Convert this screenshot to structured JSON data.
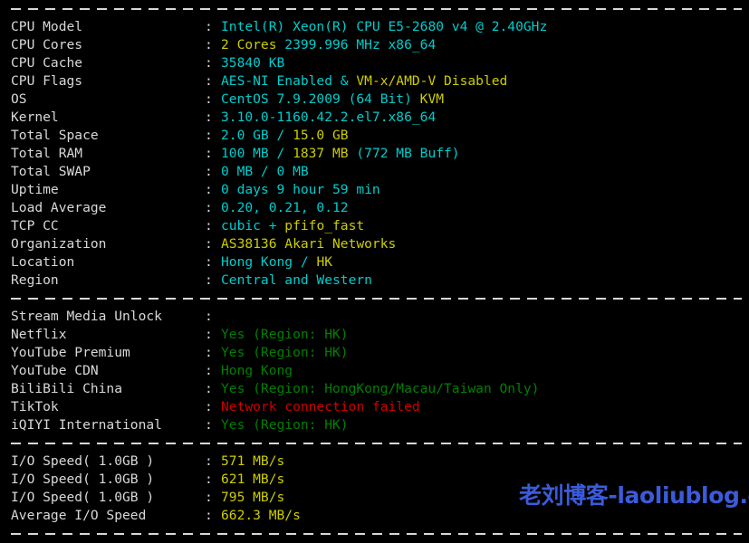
{
  "terminal": {
    "separator_char": "-",
    "colon": ":"
  },
  "watermark": {
    "text": "老刘博客-laoliublog.cn",
    "color": "#3b5bdb"
  },
  "colors": {
    "background": "#000000",
    "label": "#d8d8d8",
    "cyan": "#00cdcd",
    "yellow": "#cdcd00",
    "green": "#008000",
    "red": "#cd0000"
  },
  "sections": [
    {
      "id": "system-info",
      "rows": [
        {
          "label": "CPU Model",
          "parts": [
            {
              "text": "Intel(R) Xeon(R) CPU E5-2680 v4 @ 2.40GHz",
              "color": "cyan"
            }
          ]
        },
        {
          "label": "CPU Cores",
          "parts": [
            {
              "text": "2 Cores ",
              "color": "yellow"
            },
            {
              "text": "2399.996 MHz x86_64",
              "color": "cyan"
            }
          ]
        },
        {
          "label": "CPU Cache",
          "parts": [
            {
              "text": "35840 KB",
              "color": "cyan"
            }
          ]
        },
        {
          "label": "CPU Flags",
          "parts": [
            {
              "text": "AES-NI Enabled ",
              "color": "cyan"
            },
            {
              "text": "& ",
              "color": "cyan"
            },
            {
              "text": "VM-x/AMD-V Disabled",
              "color": "yellow"
            }
          ]
        },
        {
          "label": "OS",
          "parts": [
            {
              "text": "CentOS 7.9.2009 (64 Bit) ",
              "color": "cyan"
            },
            {
              "text": "KVM",
              "color": "yellow"
            }
          ]
        },
        {
          "label": "Kernel",
          "parts": [
            {
              "text": "3.10.0-1160.42.2.el7.x86_64",
              "color": "cyan"
            }
          ]
        },
        {
          "label": "Total Space",
          "parts": [
            {
              "text": "2.0 GB / ",
              "color": "cyan"
            },
            {
              "text": "15.0 GB",
              "color": "yellow"
            }
          ]
        },
        {
          "label": "Total RAM",
          "parts": [
            {
              "text": "100 MB / ",
              "color": "cyan"
            },
            {
              "text": "1837 MB ",
              "color": "yellow"
            },
            {
              "text": "(772 MB Buff)",
              "color": "cyan"
            }
          ]
        },
        {
          "label": "Total SWAP",
          "parts": [
            {
              "text": "0 MB / 0 MB",
              "color": "cyan"
            }
          ]
        },
        {
          "label": "Uptime",
          "parts": [
            {
              "text": "0 days 9 hour 59 min",
              "color": "cyan"
            }
          ]
        },
        {
          "label": "Load Average",
          "parts": [
            {
              "text": "0.20, 0.21, 0.12",
              "color": "cyan"
            }
          ]
        },
        {
          "label": "TCP CC",
          "parts": [
            {
              "text": "cubic + ",
              "color": "cyan"
            },
            {
              "text": "pfifo_fast",
              "color": "yellow"
            }
          ]
        },
        {
          "label": "Organization",
          "parts": [
            {
              "text": "AS38136 Akari Networks",
              "color": "yellow"
            }
          ]
        },
        {
          "label": "Location",
          "parts": [
            {
              "text": "Hong Kong / ",
              "color": "cyan"
            },
            {
              "text": "HK",
              "color": "yellow"
            }
          ]
        },
        {
          "label": "Region",
          "parts": [
            {
              "text": "Central and Western",
              "color": "cyan"
            }
          ]
        }
      ]
    },
    {
      "id": "stream-media-unlock",
      "rows": [
        {
          "label": "Stream Media Unlock",
          "parts": []
        },
        {
          "label": "Netflix",
          "parts": [
            {
              "text": "Yes (Region: HK)",
              "color": "green"
            }
          ]
        },
        {
          "label": "YouTube Premium",
          "parts": [
            {
              "text": "Yes (Region: HK)",
              "color": "green"
            }
          ]
        },
        {
          "label": "YouTube CDN",
          "parts": [
            {
              "text": "Hong Kong",
              "color": "green"
            }
          ]
        },
        {
          "label": "BiliBili China",
          "parts": [
            {
              "text": "Yes (Region: HongKong/Macau/Taiwan Only)",
              "color": "green"
            }
          ]
        },
        {
          "label": "TikTok",
          "parts": [
            {
              "text": "Network connection failed",
              "color": "red"
            }
          ]
        },
        {
          "label": "iQIYI International",
          "parts": [
            {
              "text": "Yes (Region: HK)",
              "color": "green"
            }
          ]
        }
      ]
    },
    {
      "id": "io-speed",
      "rows": [
        {
          "label": "I/O Speed( 1.0GB )",
          "parts": [
            {
              "text": "571 MB/s",
              "color": "yellow"
            }
          ]
        },
        {
          "label": "I/O Speed( 1.0GB )",
          "parts": [
            {
              "text": "621 MB/s",
              "color": "yellow"
            }
          ]
        },
        {
          "label": "I/O Speed( 1.0GB )",
          "parts": [
            {
              "text": "795 MB/s",
              "color": "yellow"
            }
          ]
        },
        {
          "label": "Average I/O Speed",
          "parts": [
            {
              "text": "662.3 MB/s",
              "color": "yellow"
            }
          ]
        }
      ]
    }
  ]
}
